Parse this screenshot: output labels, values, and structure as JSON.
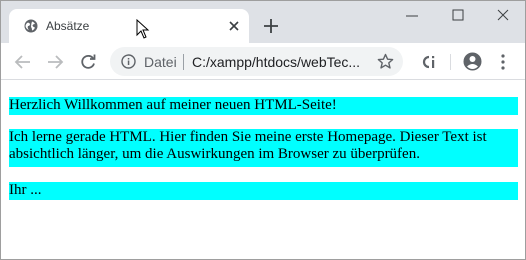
{
  "tab": {
    "title": "Absätze",
    "favicon": "globe-icon",
    "close": "close-icon"
  },
  "toolbar": {
    "back": "back-arrow-icon",
    "forward": "forward-arrow-icon",
    "reload": "reload-icon",
    "scheme_label": "Datei",
    "url": "C:/xampp/htdocs/webTec...",
    "bookmark": "star-icon",
    "extension": "extension-icon",
    "account": "account-icon",
    "menu": "kebab-menu-icon"
  },
  "page": {
    "paragraphs": [
      "Herzlich Willkommen auf meiner neuen HTML-Seite!",
      "Ich lerne gerade HTML. Hier finden Sie meine erste Homepage. Dieser Text ist absichtlich länger, um die Auswirkungen im Browser zu überprüfen.",
      "Ihr ..."
    ],
    "paragraph_background": "#00ffff"
  },
  "colors": {
    "tabstrip": "#dee1e6",
    "omnibox": "#f1f3f4",
    "icon": "#5f6368"
  }
}
